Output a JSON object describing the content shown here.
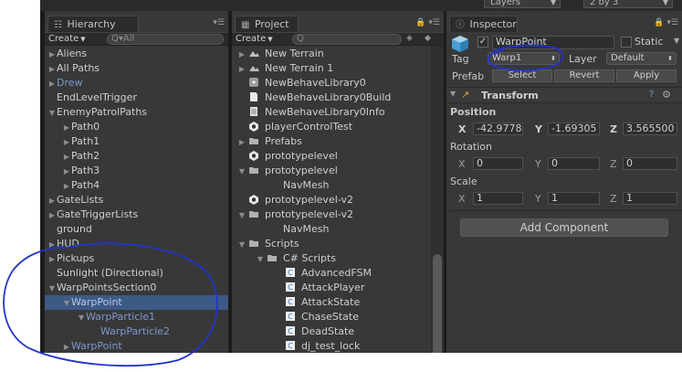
{
  "top_bar": {
    "layers": "Layers",
    "layout": "2 by 3"
  },
  "hierarchy": {
    "tab_label": "Hierarchy",
    "create_label": "Create",
    "search_placeholder": "Q▾All",
    "items": [
      {
        "label": "Aliens",
        "arrow": "▶",
        "indent": 0,
        "style": ""
      },
      {
        "label": "All Paths",
        "arrow": "▶",
        "indent": 0,
        "style": ""
      },
      {
        "label": "Drew",
        "arrow": "▶",
        "indent": 0,
        "style": "blue"
      },
      {
        "label": "EndLevelTrigger",
        "arrow": "",
        "indent": 0,
        "style": ""
      },
      {
        "label": "EnemyPatrolPaths",
        "arrow": "▼",
        "indent": 0,
        "style": ""
      },
      {
        "label": "Path0",
        "arrow": "▶",
        "indent": 1,
        "style": ""
      },
      {
        "label": "Path1",
        "arrow": "▶",
        "indent": 1,
        "style": ""
      },
      {
        "label": "Path2",
        "arrow": "▶",
        "indent": 1,
        "style": ""
      },
      {
        "label": "Path3",
        "arrow": "▶",
        "indent": 1,
        "style": ""
      },
      {
        "label": "Path4",
        "arrow": "▶",
        "indent": 1,
        "style": ""
      },
      {
        "label": "GateLists",
        "arrow": "▶",
        "indent": 0,
        "style": ""
      },
      {
        "label": "GateTriggerLists",
        "arrow": "▶",
        "indent": 0,
        "style": ""
      },
      {
        "label": "ground",
        "arrow": "",
        "indent": 0,
        "style": ""
      },
      {
        "label": "HUD",
        "arrow": "▶",
        "indent": 0,
        "style": ""
      },
      {
        "label": "Pickups",
        "arrow": "▶",
        "indent": 0,
        "style": ""
      },
      {
        "label": "Sunlight (Directional)",
        "arrow": "",
        "indent": 0,
        "style": ""
      },
      {
        "label": "WarpPointsSection0",
        "arrow": "▼",
        "indent": 0,
        "style": ""
      },
      {
        "label": "WarpPoint",
        "arrow": "▼",
        "indent": 1,
        "style": "selected"
      },
      {
        "label": "WarpParticle1",
        "arrow": "▼",
        "indent": 2,
        "style": "blue"
      },
      {
        "label": "WarpParticle2",
        "arrow": "",
        "indent": 3,
        "style": "blue"
      },
      {
        "label": "WarpPoint",
        "arrow": "▶",
        "indent": 1,
        "style": "blue"
      }
    ]
  },
  "project": {
    "tab_label": "Project",
    "create_label": "Create",
    "items": [
      {
        "label": "New Terrain",
        "arrow": "▶",
        "icon": "terrain-icon",
        "indent": 0
      },
      {
        "label": "New Terrain 1",
        "arrow": "▶",
        "icon": "terrain-icon",
        "indent": 0
      },
      {
        "label": "NewBehaveLibrary0",
        "arrow": "",
        "icon": "asset-icon",
        "indent": 0
      },
      {
        "label": "NewBehaveLibrary0Build",
        "arrow": "",
        "icon": "file-icon",
        "indent": 0
      },
      {
        "label": "NewBehaveLibrary0Info",
        "arrow": "",
        "icon": "doc-icon",
        "indent": 0
      },
      {
        "label": "playerControlTest",
        "arrow": "",
        "icon": "unity-scene-icon",
        "indent": 0
      },
      {
        "label": "Prefabs",
        "arrow": "▶",
        "icon": "folder-icon",
        "indent": 0
      },
      {
        "label": "prototypelevel",
        "arrow": "",
        "icon": "unity-scene-icon",
        "indent": 0
      },
      {
        "label": "prototypelevel",
        "arrow": "▼",
        "icon": "folder-icon",
        "indent": 0
      },
      {
        "label": "NavMesh",
        "arrow": "",
        "icon": "",
        "indent": 1
      },
      {
        "label": "prototypelevel-v2",
        "arrow": "",
        "icon": "unity-scene-icon",
        "indent": 0
      },
      {
        "label": "prototypelevel-v2",
        "arrow": "▼",
        "icon": "folder-icon",
        "indent": 0
      },
      {
        "label": "NavMesh",
        "arrow": "",
        "icon": "",
        "indent": 1
      },
      {
        "label": "Scripts",
        "arrow": "▼",
        "icon": "folder-icon",
        "indent": 0
      },
      {
        "label": "C# Scripts",
        "arrow": "▼",
        "icon": "folder-icon",
        "indent": 1
      },
      {
        "label": "AdvancedFSM",
        "arrow": "",
        "icon": "cs-script-icon",
        "indent": 2
      },
      {
        "label": "AttackPlayer",
        "arrow": "",
        "icon": "cs-script-icon",
        "indent": 2
      },
      {
        "label": "AttackState",
        "arrow": "",
        "icon": "cs-script-icon",
        "indent": 2
      },
      {
        "label": "ChaseState",
        "arrow": "",
        "icon": "cs-script-icon",
        "indent": 2
      },
      {
        "label": "DeadState",
        "arrow": "",
        "icon": "cs-script-icon",
        "indent": 2
      },
      {
        "label": "dj_test_lock",
        "arrow": "",
        "icon": "cs-script-icon",
        "indent": 2
      }
    ]
  },
  "inspector": {
    "tab_label": "Inspector",
    "object_name": "WarpPoint",
    "active_checked": true,
    "static_label": "Static",
    "tag_label": "Tag",
    "tag_value": "Warp1",
    "layer_label": "Layer",
    "layer_value": "Default",
    "prefab_label": "Prefab",
    "prefab_select": "Select",
    "prefab_revert": "Revert",
    "prefab_apply": "Apply",
    "transform_label": "Transform",
    "position_label": "Position",
    "position": {
      "x": "-42.9778",
      "y": "-1.69305",
      "z": "3.565500"
    },
    "rotation_label": "Rotation",
    "rotation": {
      "x": "0",
      "y": "0",
      "z": "0"
    },
    "scale_label": "Scale",
    "scale": {
      "x": "1",
      "y": "1",
      "z": "1"
    },
    "add_component": "Add Component",
    "axis_x": "X",
    "axis_y": "Y",
    "axis_z": "Z"
  },
  "annotation_color": "#2233cc"
}
